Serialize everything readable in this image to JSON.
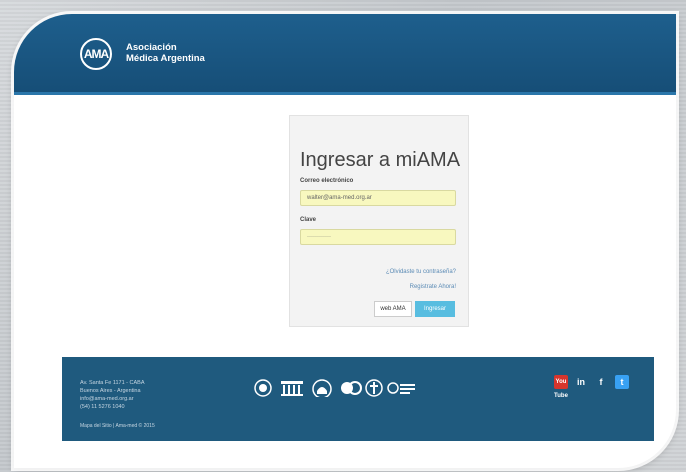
{
  "header": {
    "logo_text": "AMA",
    "org_line1": "Asociación",
    "org_line2": "Médica Argentina"
  },
  "login": {
    "title": "Ingresar a miAMA",
    "email_label": "Correo electrónico",
    "email_value": "walter@ama-med.org.ar",
    "password_label": "Clave",
    "password_value": "············",
    "forgot_link": "¿Olvidaste tu contraseña?",
    "register_link": "Registrate Ahora!",
    "web_button": "web AMA",
    "submit_button": "Ingresar"
  },
  "footer": {
    "address1": "Av. Santa Fe 1171 - CABA",
    "address2": "Buenos Aires - Argentina",
    "email": "info@ama-med.org.ar",
    "phone": "(54) 11 5276 1040",
    "bottom": "Mapa del Sitio | Ama-med © 2015",
    "social": [
      "You Tube",
      "in",
      "f",
      "t"
    ]
  },
  "colors": {
    "header": "#1e5f8d",
    "footer": "#1f5a7e",
    "button": "#58bde0"
  }
}
